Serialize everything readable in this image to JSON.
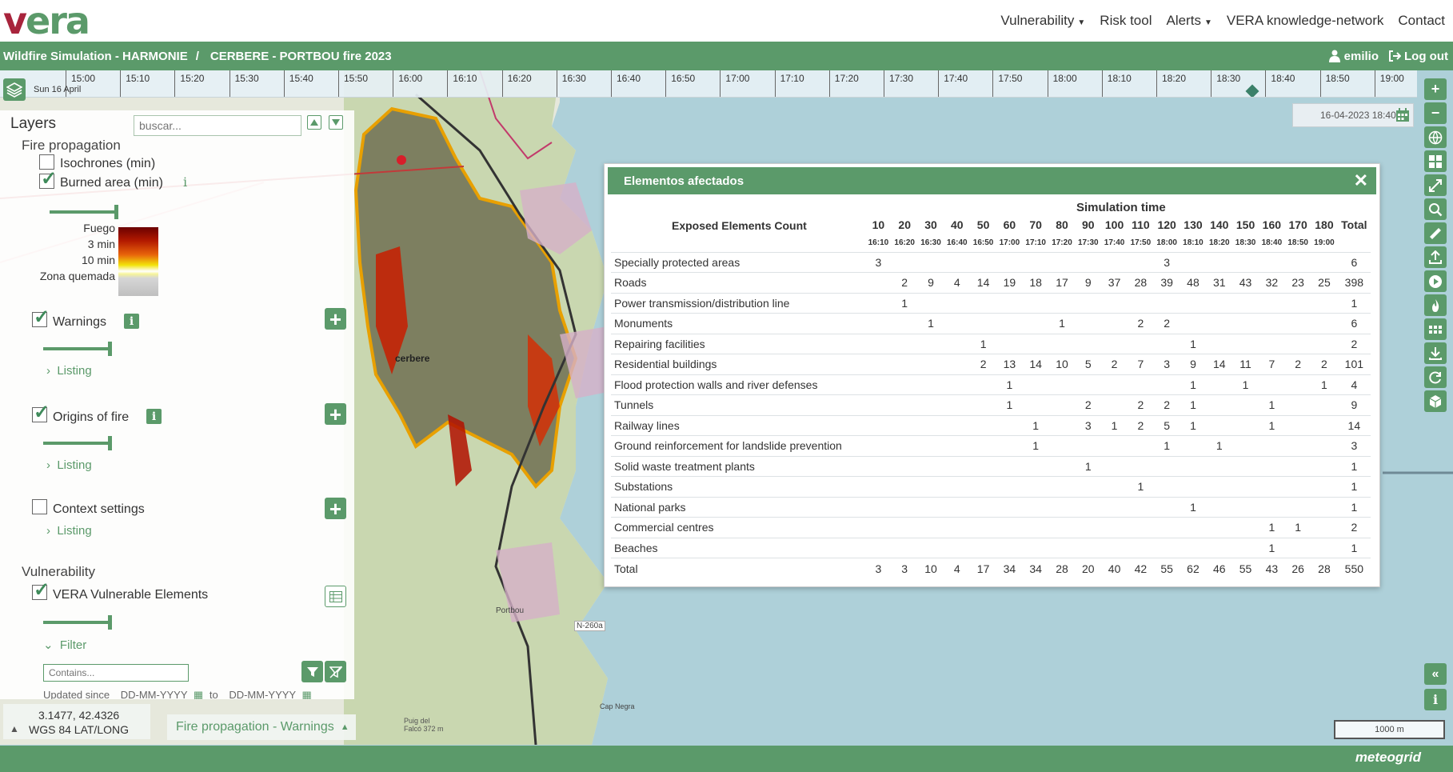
{
  "logo": "vera",
  "nav": {
    "items": [
      {
        "label": "Vulnerability",
        "dropdown": true
      },
      {
        "label": "Risk tool",
        "dropdown": false
      },
      {
        "label": "Alerts",
        "dropdown": true
      },
      {
        "label": "VERA knowledge-network",
        "dropdown": false
      },
      {
        "label": "Contact",
        "dropdown": false
      }
    ]
  },
  "breadcrumb": {
    "part1": "Wildfire Simulation - HARMONIE",
    "separator": "/",
    "part2": "CERBERE - PORTBOU fire 2023"
  },
  "user": {
    "name": "emilio",
    "logout": "Log out"
  },
  "timeline": {
    "date": "Sun 16 April",
    "ticks": [
      "15:00",
      "15:10",
      "15:20",
      "15:30",
      "15:40",
      "15:50",
      "16:00",
      "16:10",
      "16:20",
      "16:30",
      "16:40",
      "16:50",
      "17:00",
      "17:10",
      "17:20",
      "17:30",
      "17:40",
      "17:50",
      "18:00",
      "18:10",
      "18:20",
      "18:30",
      "18:40",
      "18:50",
      "19:00"
    ]
  },
  "datetime": "16-04-2023 18:40",
  "layers": {
    "title": "Layers",
    "search_placeholder": "buscar...",
    "fire_propagation": "Fire propagation",
    "isochrones": "Isochrones (min)",
    "burned_area": "Burned area (min)",
    "info_i": "i",
    "legend": [
      "Fuego",
      "3 min",
      "10 min",
      "Zona quemada"
    ],
    "warnings": "Warnings",
    "listing": "Listing",
    "origins": "Origins of fire",
    "context": "Context settings",
    "vulnerability": "Vulnerability",
    "vera_elements": "VERA Vulnerable Elements",
    "filter": "Filter",
    "filter_placeholder": "Contains...",
    "updated_since": "Updated since",
    "date_placeholder_from": "DD-MM-YYYY",
    "to": "to",
    "date_placeholder_to": "DD-MM-YYYY"
  },
  "coords": {
    "value": "3.1477, 42.4326",
    "system": "WGS 84 LAT/LONG"
  },
  "fire_warnings_tab": "Fire propagation - Warnings",
  "scale": "1000 m",
  "footer_brand": "meteogrid",
  "map_labels": {
    "town1": "cerbere",
    "town2": "Portbou",
    "road": "N-260a",
    "peak": "Puig del Falcó 372 m",
    "cape": "Cap Negra"
  },
  "popup": {
    "title": "Elementos afectados",
    "close": "✕",
    "simulation_time": "Simulation time",
    "exposed_title": "Exposed Elements Count",
    "minutes": [
      "10",
      "20",
      "30",
      "40",
      "50",
      "60",
      "70",
      "80",
      "90",
      "100",
      "110",
      "120",
      "130",
      "140",
      "150",
      "160",
      "170",
      "180"
    ],
    "total_label": "Total",
    "times": [
      "16:10",
      "16:20",
      "16:30",
      "16:40",
      "16:50",
      "17:00",
      "17:10",
      "17:20",
      "17:30",
      "17:40",
      "17:50",
      "18:00",
      "18:10",
      "18:20",
      "18:30",
      "18:40",
      "18:50",
      "19:00"
    ],
    "rows": [
      {
        "name": "Specially protected areas",
        "values": [
          "3",
          "",
          "",
          "",
          "",
          "",
          "",
          "",
          "",
          "",
          "",
          "3",
          "",
          "",
          "",
          "",
          "",
          ""
        ],
        "total": "6"
      },
      {
        "name": "Roads",
        "values": [
          "",
          "2",
          "9",
          "4",
          "14",
          "19",
          "18",
          "17",
          "9",
          "37",
          "28",
          "39",
          "48",
          "31",
          "43",
          "32",
          "23",
          "25"
        ],
        "total": "398"
      },
      {
        "name": "Power transmission/distribution line",
        "values": [
          "",
          "1",
          "",
          "",
          "",
          "",
          "",
          "",
          "",
          "",
          "",
          "",
          "",
          "",
          "",
          "",
          "",
          ""
        ],
        "total": "1"
      },
      {
        "name": "Monuments",
        "values": [
          "",
          "",
          "1",
          "",
          "",
          "",
          "",
          "1",
          "",
          "",
          "2",
          "2",
          "",
          "",
          "",
          "",
          "",
          ""
        ],
        "total": "6"
      },
      {
        "name": "Repairing facilities",
        "values": [
          "",
          "",
          "",
          "",
          "1",
          "",
          "",
          "",
          "",
          "",
          "",
          "",
          "1",
          "",
          "",
          "",
          "",
          ""
        ],
        "total": "2"
      },
      {
        "name": "Residential buildings",
        "values": [
          "",
          "",
          "",
          "",
          "2",
          "13",
          "14",
          "10",
          "5",
          "2",
          "7",
          "3",
          "9",
          "14",
          "11",
          "7",
          "2",
          "2"
        ],
        "total": "101"
      },
      {
        "name": "Flood protection walls and river defenses",
        "values": [
          "",
          "",
          "",
          "",
          "",
          "1",
          "",
          "",
          "",
          "",
          "",
          "",
          "1",
          "",
          "1",
          "",
          "",
          "1"
        ],
        "total": "4"
      },
      {
        "name": "Tunnels",
        "values": [
          "",
          "",
          "",
          "",
          "",
          "1",
          "",
          "",
          "2",
          "",
          "2",
          "2",
          "1",
          "",
          "",
          "1",
          "",
          ""
        ],
        "total": "9"
      },
      {
        "name": "Railway lines",
        "values": [
          "",
          "",
          "",
          "",
          "",
          "",
          "1",
          "",
          "3",
          "1",
          "2",
          "5",
          "1",
          "",
          "",
          "1",
          "",
          ""
        ],
        "total": "14"
      },
      {
        "name": "Ground reinforcement for landslide prevention",
        "values": [
          "",
          "",
          "",
          "",
          "",
          "",
          "1",
          "",
          "",
          "",
          "",
          "1",
          "",
          "1",
          "",
          "",
          "",
          ""
        ],
        "total": "3"
      },
      {
        "name": "Solid waste treatment plants",
        "values": [
          "",
          "",
          "",
          "",
          "",
          "",
          "",
          "",
          "1",
          "",
          "",
          "",
          "",
          "",
          "",
          "",
          "",
          ""
        ],
        "total": "1"
      },
      {
        "name": "Substations",
        "values": [
          "",
          "",
          "",
          "",
          "",
          "",
          "",
          "",
          "",
          "",
          "1",
          "",
          "",
          "",
          "",
          "",
          "",
          ""
        ],
        "total": "1"
      },
      {
        "name": "National parks",
        "values": [
          "",
          "",
          "",
          "",
          "",
          "",
          "",
          "",
          "",
          "",
          "",
          "",
          "1",
          "",
          "",
          "",
          "",
          ""
        ],
        "total": "1"
      },
      {
        "name": "Commercial centres",
        "values": [
          "",
          "",
          "",
          "",
          "",
          "",
          "",
          "",
          "",
          "",
          "",
          "",
          "",
          "",
          "",
          "1",
          "1",
          ""
        ],
        "total": "2"
      },
      {
        "name": "Beaches",
        "values": [
          "",
          "",
          "",
          "",
          "",
          "",
          "",
          "",
          "",
          "",
          "",
          "",
          "",
          "",
          "",
          "1",
          "",
          ""
        ],
        "total": "1"
      },
      {
        "name": "Total",
        "values": [
          "3",
          "3",
          "10",
          "4",
          "17",
          "34",
          "34",
          "28",
          "20",
          "40",
          "42",
          "55",
          "62",
          "46",
          "55",
          "43",
          "26",
          "28"
        ],
        "total": "550"
      }
    ]
  },
  "colors": {
    "brand_green": "#5b9a6a",
    "logo_red": "#a8243c",
    "sea": "#aed0d9"
  }
}
